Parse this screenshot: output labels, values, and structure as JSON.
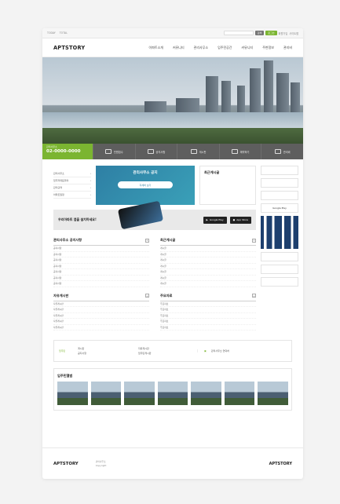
{
  "util": {
    "links": [
      "TODAY",
      "TOTAL"
    ],
    "search_btn": "검색",
    "login_btn": "로그인",
    "member_links": [
      "회원가입",
      "사이트맵"
    ]
  },
  "header": {
    "logo": "APTSTORY",
    "menu": [
      "아파트소개",
      "커뮤니티",
      "관리사무소",
      "입주민공간",
      "커뮤니티",
      "주변정보",
      "관리비"
    ]
  },
  "quick": {
    "call_label": "관리사무소",
    "call_number": "02-0000-0000",
    "items": [
      "민원접수",
      "공지사항",
      "게시판",
      "예약하기",
      "관리비"
    ]
  },
  "side_menu": [
    "관리사무소",
    "입주자대표회의",
    "관리규약",
    "아파트일정"
  ],
  "notice_card": {
    "title": "관리사무소 공지",
    "button": "자세히 보기"
  },
  "recent": {
    "title": "최근게시글"
  },
  "app": {
    "title": "우리아파트 앱을 설치하세요!",
    "google": "Google Play",
    "apple": "App Store"
  },
  "boards": [
    {
      "title": "관리사무소 공지사항",
      "rows": [
        "공지사항",
        "공지사항",
        "공지사항",
        "공지사항",
        "공지사항",
        "공지사항",
        "공지사항"
      ]
    },
    {
      "title": "최근게시글",
      "rows": [
        "게시글",
        "게시글",
        "게시글",
        "게시글",
        "게시글",
        "게시글",
        "게시글"
      ]
    },
    {
      "title": "자유게시판",
      "rows": [
        "자유게시판",
        "자유게시판",
        "자유게시판",
        "자유게시판",
        "자유게시판"
      ]
    },
    {
      "title": "주요자료",
      "rows": [
        "주요자료",
        "주요자료",
        "주요자료",
        "주요자료",
        "주요자료"
      ]
    }
  ],
  "right_banners": [
    "Google Play"
  ],
  "bottom": {
    "label": "입주민",
    "links": [
      "게시판",
      "자유게시판",
      "공지사항",
      "입주민게시판"
    ],
    "right_title": "관리사무소 연락처"
  },
  "gallery": {
    "title": "입주민앨범"
  },
  "footer": {
    "logo": "APTSTORY",
    "info_line1": "관리사무소",
    "info_line2": "Copyright",
    "logo_right": "APTSTORY"
  },
  "colors": {
    "accent_green": "#7bb531",
    "notice_blue": "#2e7fa4",
    "quickbar": "#5e5e5e"
  }
}
